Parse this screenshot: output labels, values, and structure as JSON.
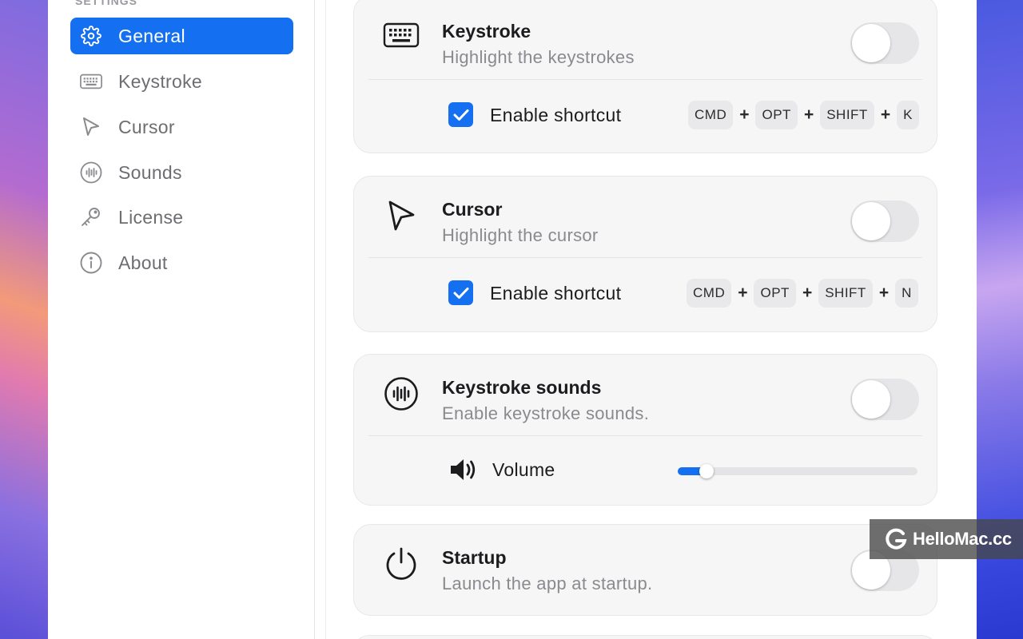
{
  "sidebar": {
    "heading": "SETTINGS",
    "items": [
      {
        "label": "General",
        "icon": "gear-icon",
        "active": true
      },
      {
        "label": "Keystroke",
        "icon": "keyboard-icon",
        "active": false
      },
      {
        "label": "Cursor",
        "icon": "cursor-icon",
        "active": false
      },
      {
        "label": "Sounds",
        "icon": "sound-wave-icon",
        "active": false
      },
      {
        "label": "License",
        "icon": "key-icon",
        "active": false
      },
      {
        "label": "About",
        "icon": "info-icon",
        "active": false
      }
    ]
  },
  "cards": {
    "keystroke": {
      "title": "Keystroke",
      "subtitle": "Highlight the keystrokes",
      "enabled": false,
      "shortcut_label": "Enable shortcut",
      "shortcut_checked": true,
      "keys": [
        "CMD",
        "OPT",
        "SHIFT",
        "K"
      ],
      "separator": "+"
    },
    "cursor": {
      "title": "Cursor",
      "subtitle": "Highlight the cursor",
      "enabled": false,
      "shortcut_label": "Enable shortcut",
      "shortcut_checked": true,
      "keys": [
        "CMD",
        "OPT",
        "SHIFT",
        "N"
      ],
      "separator": "+"
    },
    "sounds": {
      "title": "Keystroke sounds",
      "subtitle": "Enable keystroke sounds.",
      "enabled": false,
      "volume_label": "Volume",
      "volume_level": 0.1
    },
    "startup": {
      "title": "Startup",
      "subtitle": "Launch the app at startup.",
      "enabled": false
    }
  },
  "watermark": {
    "text": "HelloMac.cc"
  },
  "colors": {
    "accent": "#1470f0",
    "card_bg": "#f6f6f7",
    "muted_text": "#8a8a8f"
  }
}
